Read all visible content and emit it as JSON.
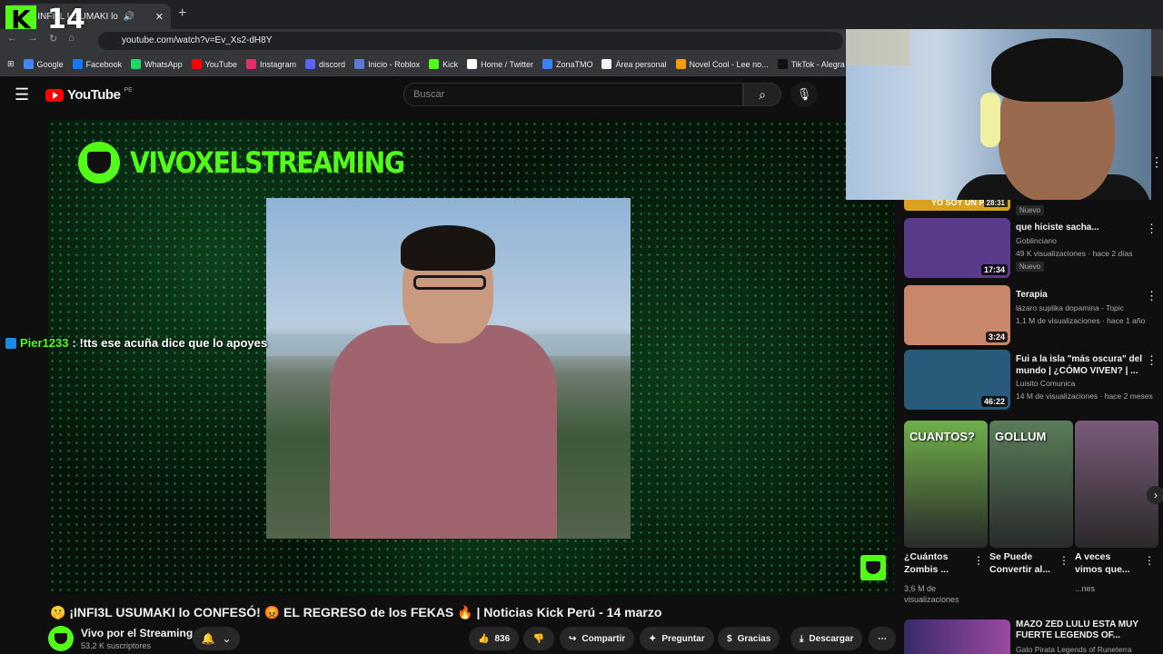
{
  "browser": {
    "tab_title": "¡INFI3L USUMAKI lo",
    "tab_close": "✕",
    "new_tab": "+",
    "url": "youtube.com/watch?v=Ev_Xs2-dH8Y",
    "bookmarks": [
      {
        "label": "Google",
        "color": "#4285f4"
      },
      {
        "label": "Facebook",
        "color": "#1877f2"
      },
      {
        "label": "WhatsApp",
        "color": "#25d366"
      },
      {
        "label": "YouTube",
        "color": "#ff0000"
      },
      {
        "label": "Instagram",
        "color": "#e1306c"
      },
      {
        "label": "discord",
        "color": "#5865f2"
      },
      {
        "label": "Inicio - Roblox",
        "color": "#5b7bd5"
      },
      {
        "label": "Kick",
        "color": "#53fc18"
      },
      {
        "label": "Home / Twitter",
        "color": "#ffffff"
      },
      {
        "label": "ZonaTMO",
        "color": "#3b82f6"
      },
      {
        "label": "Área personal",
        "color": "#f3f3f3"
      },
      {
        "label": "Novel Cool - Lee no...",
        "color": "#f59e0b"
      },
      {
        "label": "TikTok - Alegra tu",
        "color": "#111111"
      }
    ]
  },
  "overlay": {
    "kick_logo": "K",
    "kick_number": "14",
    "chat_user": "Pier1233",
    "chat_text": ": !tts ese acuña dice que lo apoyes"
  },
  "youtube": {
    "logo_text": "YouTube",
    "country": "PE",
    "search_placeholder": "Buscar",
    "channel_banner": "VIVOXELSTREAMING",
    "video_title": "🤫 ¡INFI3L USUMAKI lo CONFESÓ! 😡 EL REGRESO de los FEKAS 🔥 | Noticias Kick Perú - 14 marzo",
    "owner_name": "Vivo por el Streaming",
    "owner_subs": "53,2 K suscriptores",
    "actions": {
      "likes": "836",
      "share": "Compartir",
      "ask": "Preguntar",
      "thanks": "Gracias",
      "download": "Descargar"
    }
  },
  "sidebar": {
    "top_partial": {
      "banner": "YO SOY UN PAY",
      "duration": "28:31",
      "badge": "Nuevo"
    },
    "recommendations": [
      {
        "title": "que hiciste sacha...",
        "channel": "Goblinciano",
        "meta": "49 K visualizaciones · hace 2 días",
        "duration": "17:34",
        "badge": "Nuevo",
        "thumb": "#5a3a8a"
      },
      {
        "title": "Terapia",
        "channel": "lázaro suplika dopamina - Topic",
        "meta": "1,1 M de visualizaciones · hace 1 año",
        "duration": "3:24",
        "thumb": "#c8866a"
      },
      {
        "title": "Fui a la isla \"más oscura\" del mundo | ¿CÓMO VIVEN? | ...",
        "channel": "Luisito Comunica",
        "meta": "14 M de visualizaciones · hace 2 meses",
        "duration": "46:22",
        "thumb": "#2a5a7a"
      }
    ],
    "shorts": [
      {
        "title": "¿Cuántos Zombis ...",
        "meta": "3,6 M de visualizaciones",
        "label": "CUANTOS?",
        "color": "#6fb04a"
      },
      {
        "title": "Se Puede Convertir al...",
        "meta": "",
        "label": "GOLLUM",
        "color": "#5a7d5a"
      },
      {
        "title": "A veces vimos que...",
        "meta": "...nes",
        "label": "",
        "color": "#7a5a7a"
      }
    ],
    "bottom_rec": {
      "title": "MAZO ZED LULU ESTA MUY FUERTE LEGENDS OF...",
      "channel": "Gato Pirata Legends of Runeterra"
    }
  }
}
